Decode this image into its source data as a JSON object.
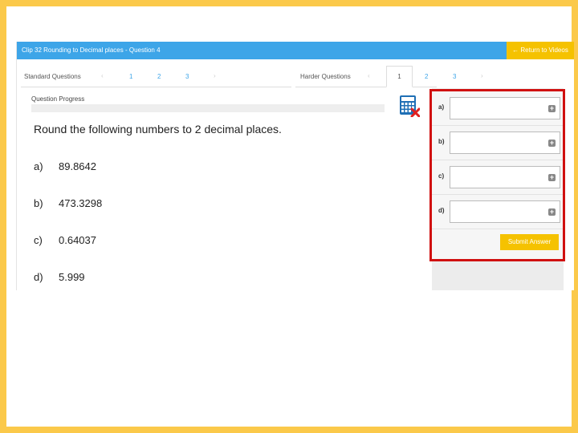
{
  "header": {
    "title": "Clip 32 Rounding to Decimal places - Question 4",
    "return_label": "← Return to Videos"
  },
  "nav": {
    "standard": {
      "label": "Standard Questions",
      "items": [
        "1",
        "2",
        "3"
      ]
    },
    "harder": {
      "label": "Harder Questions",
      "items": [
        "1",
        "2",
        "3"
      ],
      "active": "1"
    }
  },
  "progress": {
    "label": "Question Progress",
    "value": 0
  },
  "question": {
    "prompt": "Round the following numbers to 2 decimal places.",
    "items": [
      {
        "letter": "a)",
        "value": "89.8642"
      },
      {
        "letter": "b)",
        "value": "473.3298"
      },
      {
        "letter": "c)",
        "value": "0.64037"
      },
      {
        "letter": "d)",
        "value": "5.999"
      }
    ]
  },
  "answers": {
    "rows": [
      {
        "label": "a)",
        "value": ""
      },
      {
        "label": "b)",
        "value": ""
      },
      {
        "label": "c)",
        "value": ""
      },
      {
        "label": "d)",
        "value": ""
      }
    ],
    "submit_label": "Submit Answer"
  },
  "icons": {
    "calculator": "calculator-icon",
    "plus": "plus-square-icon",
    "arrow": "arrow-left-icon"
  },
  "colors": {
    "header": "#3da5e8",
    "accent": "#f5c200",
    "highlight": "#d01010",
    "background": "#fbc94a"
  }
}
